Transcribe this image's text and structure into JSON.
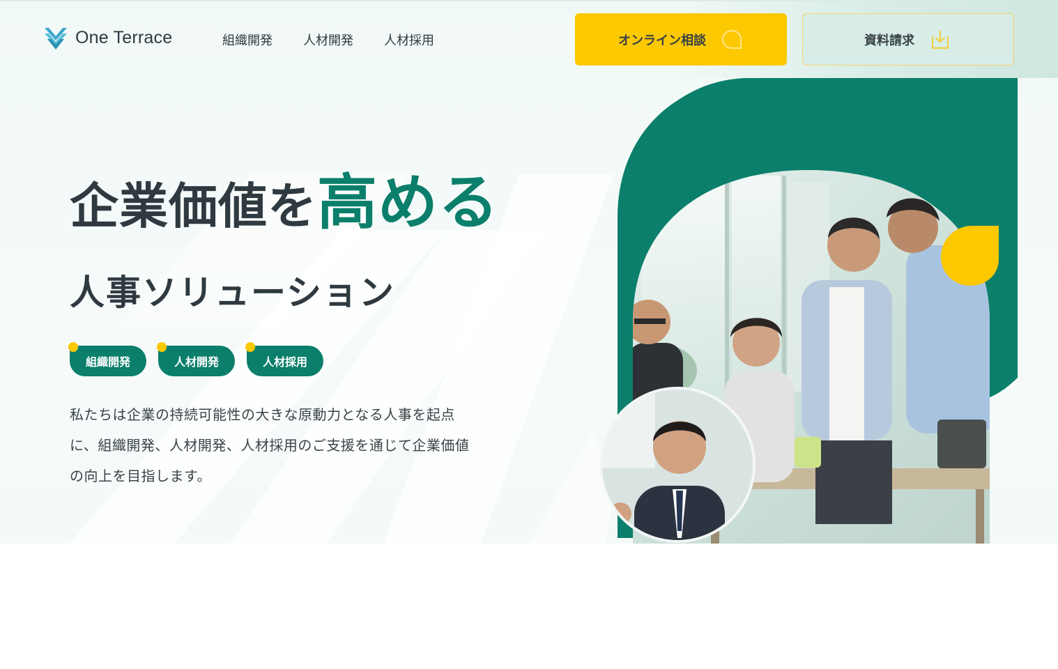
{
  "brand": {
    "name": "One Terrace"
  },
  "nav": {
    "items": [
      {
        "label": "組織開発"
      },
      {
        "label": "人材開発"
      },
      {
        "label": "人材採用"
      }
    ]
  },
  "actions": {
    "consult_label": "オンライン相談",
    "consult_icon": "speech-bubble-icon",
    "docs_label": "資料請求",
    "docs_icon": "download-icon"
  },
  "hero": {
    "headline_part1": "企業価値を",
    "headline_part2": "高める",
    "subheading": "人事ソリューション",
    "tags": [
      {
        "label": "組織開発"
      },
      {
        "label": "人材開発"
      },
      {
        "label": "人材採用"
      }
    ],
    "description": "私たちは企業の持続可能性の大きな原動力となる人事を起点に、組織開発、人材開発、人材採用のご支援を通じて企業価値の向上を目指します。"
  },
  "colors": {
    "brand_green": "#0b7f6b",
    "accent_yellow": "#fcc800",
    "text_dark": "#2f3a40",
    "hero_bg": "#f1f9f7"
  }
}
